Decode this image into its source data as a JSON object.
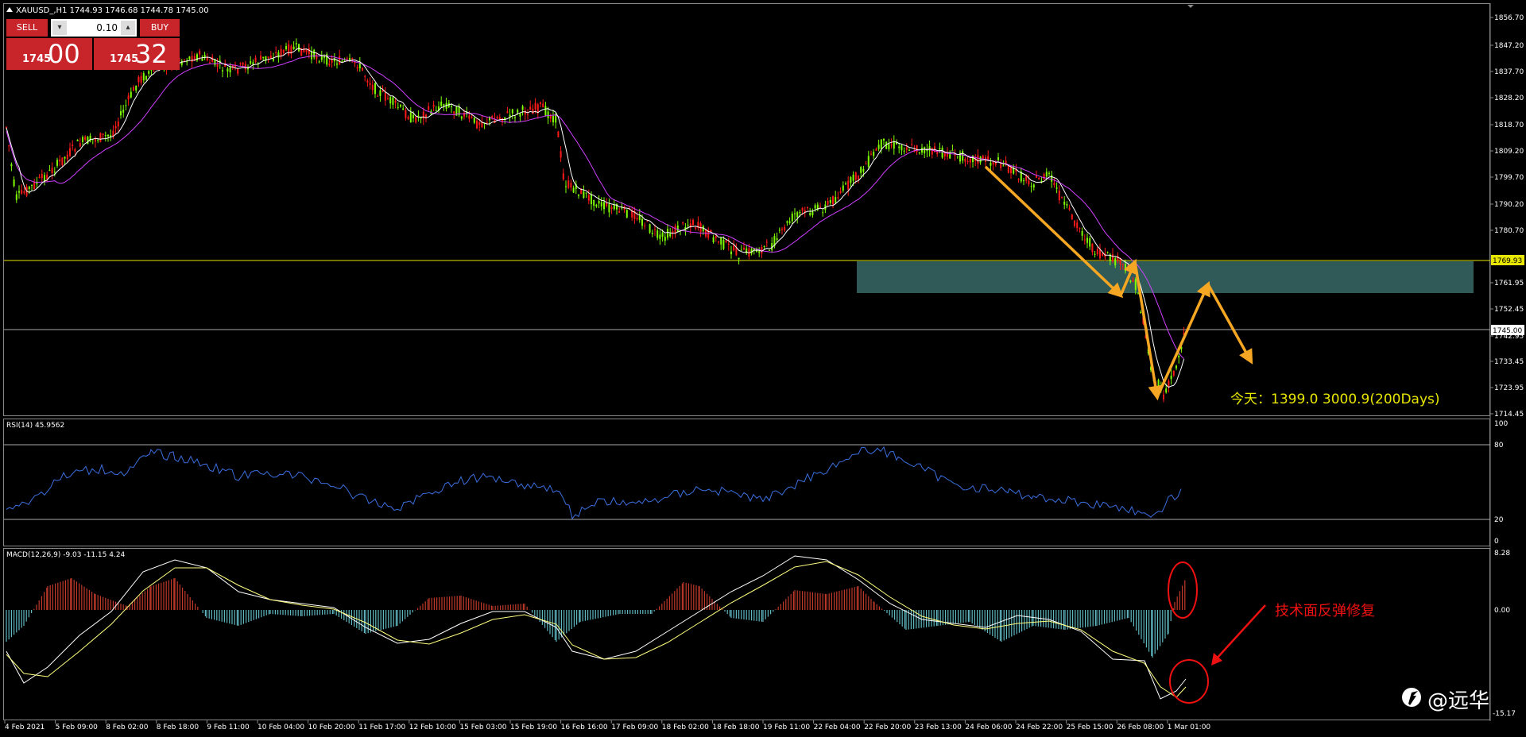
{
  "header": {
    "symbol_line": "XAUUSD_,H1 1744.93 1746.68 1744.78 1745.00"
  },
  "trade_panel": {
    "sell_label": "SELL",
    "buy_label": "BUY",
    "lot_value": "0.10",
    "sell_price_small": "1745",
    "sell_price_big": "00",
    "buy_price_small": "1745",
    "buy_price_big": "32",
    "colors": {
      "panel": "#c8252b"
    }
  },
  "price_axis": {
    "labels": [
      "1856.70",
      "1847.20",
      "1837.70",
      "1828.20",
      "1818.70",
      "1809.20",
      "1799.70",
      "1790.20",
      "1780.70",
      "1761.95",
      "1752.45",
      "1742.95",
      "1733.45",
      "1723.95",
      "1714.45"
    ],
    "resistance_tag": "1769.93",
    "current_tag": "1745.00"
  },
  "annotation_text": "今天：1399.0  3000.9(200Days)",
  "rsi": {
    "label": "RSI(14) 45.9562",
    "levels": [
      "100",
      "80",
      "20",
      "0"
    ]
  },
  "macd": {
    "label": "MACD(12,26,9) -9.03 -11.15 4.24",
    "levels": [
      "8.28",
      "0.00",
      "-15.17"
    ]
  },
  "callout": "技术面反弹修复",
  "watermark": "@远华",
  "time_axis": [
    "4 Feb 2021",
    "5 Feb 09:00",
    "8 Feb 02:00",
    "8 Feb 18:00",
    "9 Feb 11:00",
    "10 Feb 04:00",
    "10 Feb 20:00",
    "11 Feb 17:00",
    "12 Feb 10:00",
    "15 Feb 03:00",
    "15 Feb 19:00",
    "16 Feb 16:00",
    "17 Feb 09:00",
    "18 Feb 02:00",
    "18 Feb 18:00",
    "19 Feb 11:00",
    "22 Feb 04:00",
    "22 Feb 20:00",
    "23 Feb 13:00",
    "24 Feb 06:00",
    "24 Feb 22:00",
    "25 Feb 15:00",
    "26 Feb 08:00",
    "1 Mar 01:00"
  ],
  "colors": {
    "bull": "#7fff00",
    "bear": "#ff1a1a",
    "ma_fast": "#ffffff",
    "ma_slow": "#d040ff",
    "rsi_line": "#3b6fe0",
    "macd_pos": "#c0392b",
    "macd_neg": "#5fb8c0",
    "signal": "#ffff80",
    "zone": "#2f5a58",
    "arrow": "#f5a623",
    "circle": "#e11",
    "level_line": "#e6e600"
  }
}
